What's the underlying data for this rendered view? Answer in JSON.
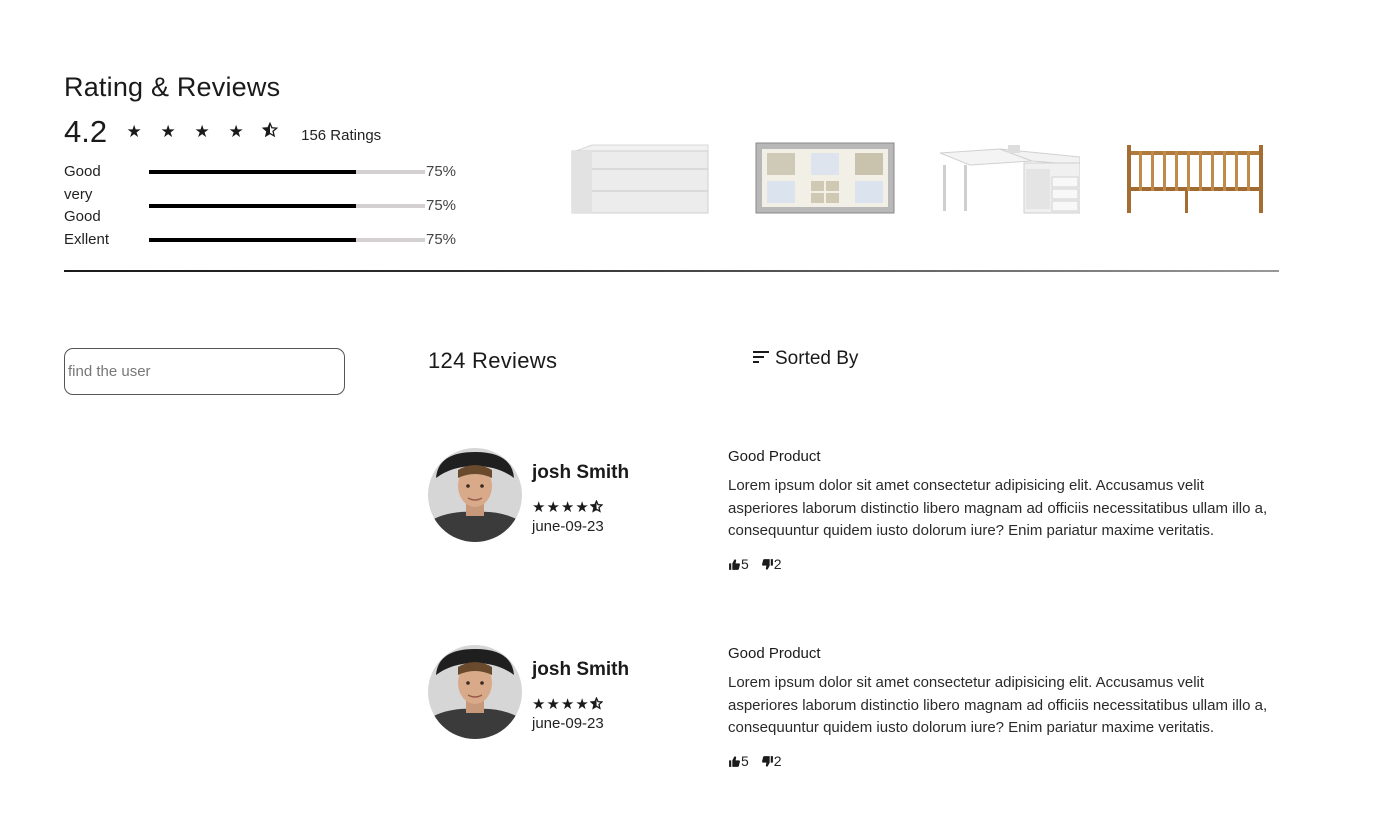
{
  "header": {
    "title": "Rating & Reviews",
    "score": "4.2",
    "stars_filled": 4,
    "stars_half": 1,
    "ratings_count": "156 Ratings"
  },
  "rating_bars": [
    {
      "label": "Good",
      "percent": 75,
      "percent_text": "75%"
    },
    {
      "label": "very Good",
      "percent": 75,
      "percent_text": "75%"
    },
    {
      "label": "Exllent",
      "percent": 75,
      "percent_text": "75%"
    }
  ],
  "products": [
    {
      "icon": "white-cabinet-image"
    },
    {
      "icon": "photo-frame-image"
    },
    {
      "icon": "white-desk-image"
    },
    {
      "icon": "wooden-crib-image"
    }
  ],
  "search": {
    "placeholder": "find the user",
    "value": ""
  },
  "reviews_header": {
    "count_label": "124 Reviews",
    "sort_label": "Sorted By",
    "sort_icon": "sort-lines-icon"
  },
  "reviews": [
    {
      "user": "josh Smith",
      "rating": 4.5,
      "date": "june-09-23",
      "title": "Good Product",
      "body": "Lorem ipsum dolor sit amet consectetur adipisicing elit. Accusamus velit asperiores laborum distinctio libero magnam ad officiis necessitatibus ullam illo a, consequuntur quidem iusto dolorum iure? Enim pariatur maxime veritatis.",
      "likes": "5",
      "dislikes": "2"
    },
    {
      "user": "josh Smith",
      "rating": 4.5,
      "date": "june-09-23",
      "title": "Good Product",
      "body": "Lorem ipsum dolor sit amet consectetur adipisicing elit. Accusamus velit asperiores laborum distinctio libero magnam ad officiis necessitatibus ullam illo a, consequuntur quidem iusto dolorum iure? Enim pariatur maxime veritatis.",
      "likes": "5",
      "dislikes": "2"
    }
  ]
}
